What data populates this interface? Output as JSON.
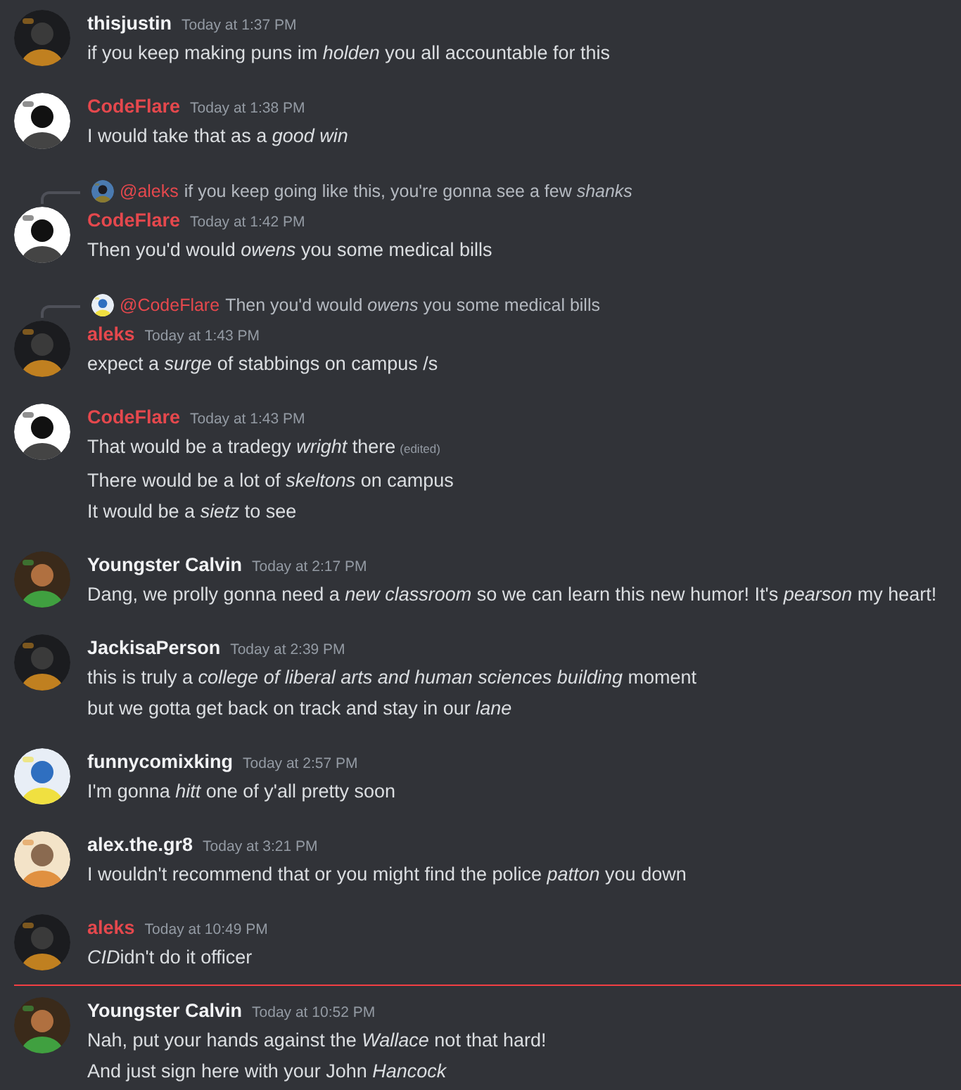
{
  "messages": [
    {
      "author": "thisjustin",
      "color": "#f2f3f5",
      "timestamp": "Today at 1:37 PM",
      "new_divider": false,
      "lines": [
        {
          "text": "if you keep making puns im *holden* you all accountable for this"
        }
      ]
    },
    {
      "author": "CodeFlare",
      "color": "#e5484d",
      "timestamp": "Today at 1:38 PM",
      "new_divider": false,
      "lines": [
        {
          "text": "I would take that as a *good win*"
        }
      ]
    },
    {
      "author": "CodeFlare",
      "color": "#e5484d",
      "timestamp": "Today at 1:42 PM",
      "new_divider": false,
      "reply": {
        "author": "@aleks",
        "color": "#e5484d",
        "text": "if you keep going like this, you're gonna see a few *shanks*"
      },
      "lines": [
        {
          "text": "Then you'd would *owens* you some medical bills"
        }
      ]
    },
    {
      "author": "aleks",
      "color": "#e5484d",
      "timestamp": "Today at 1:43 PM",
      "new_divider": false,
      "reply": {
        "author": "@CodeFlare",
        "color": "#e5484d",
        "text": "Then you'd would *owens* you some medical bills"
      },
      "lines": [
        {
          "text": "expect a *surge* of stabbings on campus /s"
        }
      ]
    },
    {
      "author": "CodeFlare",
      "color": "#e5484d",
      "timestamp": "Today at 1:43 PM",
      "new_divider": false,
      "lines": [
        {
          "text": "That would be a tradegy *wright* there",
          "edited": "(edited)"
        },
        {
          "text": "There would be a lot of *skeltons* on campus"
        },
        {
          "text": "It would be a *sietz* to see"
        }
      ]
    },
    {
      "author": "Youngster Calvin",
      "color": "#f2f3f5",
      "timestamp": "Today at 2:17 PM",
      "new_divider": false,
      "lines": [
        {
          "text": "Dang, we prolly gonna need a *new classroom* so we can learn this new humor! It's *pearson* my heart!"
        }
      ]
    },
    {
      "author": "JackisaPerson",
      "color": "#f2f3f5",
      "timestamp": "Today at 2:39 PM",
      "new_divider": false,
      "lines": [
        {
          "text": "this is truly a *college of liberal arts and human sciences building* moment"
        },
        {
          "text": "but we gotta get back on track and stay in our *lane*"
        }
      ]
    },
    {
      "author": "funnycomixking",
      "color": "#f2f3f5",
      "timestamp": "Today at 2:57 PM",
      "new_divider": false,
      "lines": [
        {
          "text": "I'm gonna *hitt* one of y'all pretty soon"
        }
      ]
    },
    {
      "author": "alex.the.gr8",
      "color": "#f2f3f5",
      "timestamp": "Today at 3:21 PM",
      "new_divider": false,
      "lines": [
        {
          "text": "I wouldn't recommend that or you might find the police *patton* you down"
        }
      ]
    },
    {
      "author": "aleks",
      "color": "#e5484d",
      "timestamp": "Today at 10:49 PM",
      "new_divider": false,
      "lines": [
        {
          "italic_start": "CID",
          "text": "idn't do it officer"
        }
      ]
    },
    {
      "author": "Youngster Calvin",
      "color": "#f2f3f5",
      "timestamp": "Today at 10:52 PM",
      "new_divider": true,
      "lines": [
        {
          "text": "Nah, put your hands against the *Wallace* not that hard!"
        },
        {
          "text": "And just sign here with your John *Hancock*"
        }
      ]
    }
  ]
}
